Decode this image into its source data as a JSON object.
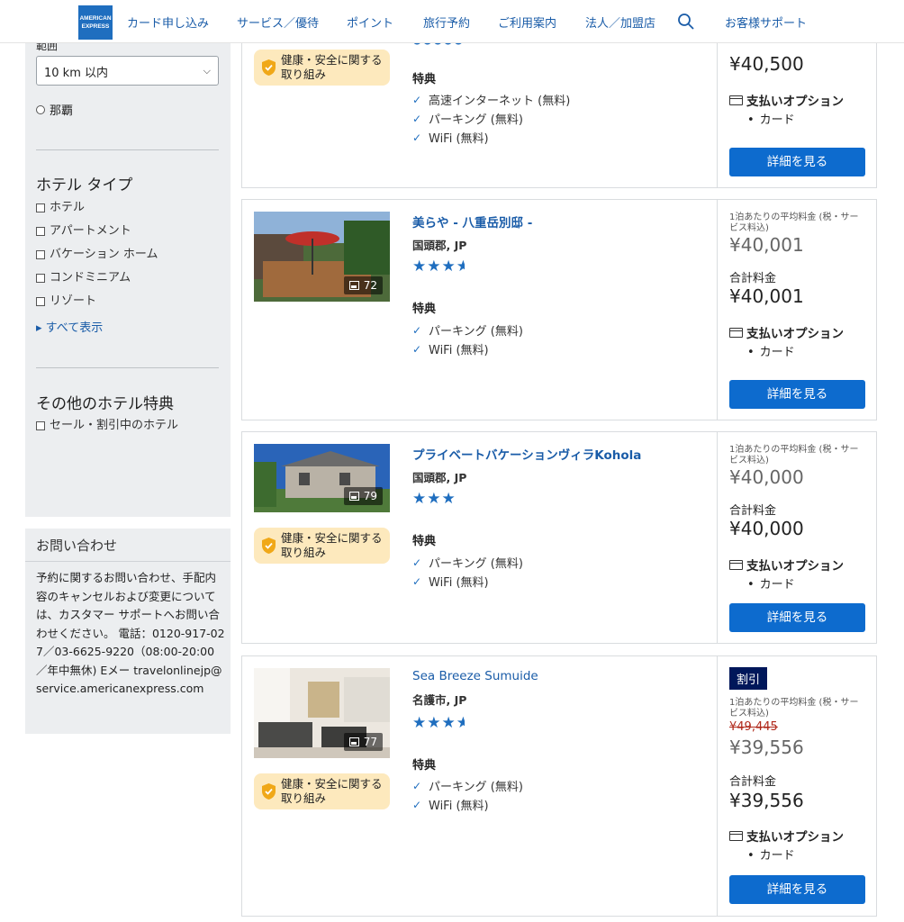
{
  "nav": {
    "logo_line1": "AMERICAN",
    "logo_line2": "EXPRESS",
    "links": [
      "カード申し込み",
      "サービス／優待",
      "ポイント",
      "旅行予約",
      "ご利用案内",
      "法人／加盟店",
      "お客様サポート"
    ]
  },
  "filters": {
    "distance_label": "範囲",
    "distance_value": "10 km 以内",
    "area_option": "那覇",
    "hotel_type_title": "ホテル タイプ",
    "hotel_types": [
      "ホテル",
      "アパートメント",
      "バケーション ホーム",
      "コンドミニアム",
      "リゾート"
    ],
    "show_all": "すべて表示",
    "other_title": "その他のホテル特典",
    "other_options": [
      "セール・割引中のホテル"
    ]
  },
  "contact": {
    "title": "お問い合わせ",
    "body": "予約に関するお問い合わせ、手配内容のキャンセルおよび変更については、カスタマー サポートへお問い合わせください。 電話：0120-917-027／03-6625-9220（08:00-20:00／年中無休) Eメー travelonlinejp@ service.americanexpress.com"
  },
  "labels": {
    "perks": "特典",
    "avg_price": "1泊あたりの平均料金 (税・サービス料込)",
    "total": "合計料金",
    "payment": "支払いオプション",
    "payment_card": "カード",
    "detail_button": "詳細を見る",
    "safety": "健康・安全に関する取り組み",
    "discount": "割引",
    "perk_internet": "高速インターネット (無料)",
    "perk_parking": "パーキング (無料)",
    "perk_wifi": "WiFi (無料)"
  },
  "hotels": [
    {
      "total_price": "¥40,500"
    },
    {
      "name": "美らや - 八重岳別邸 -",
      "location": "国頭郡, JP",
      "stars": 3.5,
      "photo_count": "72",
      "avg_price": "¥40,001",
      "total_price": "¥40,001"
    },
    {
      "name": "プライベートバケーションヴィラKohola",
      "location": "国頭郡, JP",
      "stars": 3,
      "photo_count": "79",
      "avg_price": "¥40,000",
      "total_price": "¥40,000"
    },
    {
      "name": "Sea Breeze Sumuide",
      "location": "名護市, JP",
      "stars": 3.5,
      "photo_count": "77",
      "original_price": "¥49,445",
      "avg_price": "¥39,556",
      "total_price": "¥39,556"
    }
  ],
  "colors": {
    "brand": "#1f6ebf",
    "button": "#0d6bce",
    "link": "#1a5ca8",
    "badge": "#00175a",
    "safety_bg": "#fde9bd"
  }
}
